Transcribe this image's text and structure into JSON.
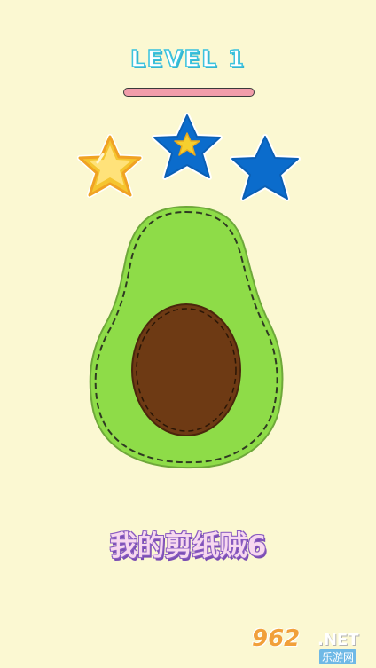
{
  "header": {
    "level_label": "LEVEL 1",
    "progress": 1.0
  },
  "stars": [
    {
      "name": "star-1",
      "state": "earned",
      "color": "#f6c83a"
    },
    {
      "name": "star-2",
      "state": "empty-with-small-gold",
      "color": "#0a6fd0"
    },
    {
      "name": "star-3",
      "state": "empty",
      "color": "#0a6fd0"
    }
  ],
  "shape": {
    "name": "avocado",
    "skin_color": "#8fdb4a",
    "pit_color": "#6e3b17"
  },
  "caption": "我的剪纸贼6",
  "watermark": {
    "logo_number": "962",
    "logo_tld": ".NET",
    "logo_sub": "乐游网"
  }
}
